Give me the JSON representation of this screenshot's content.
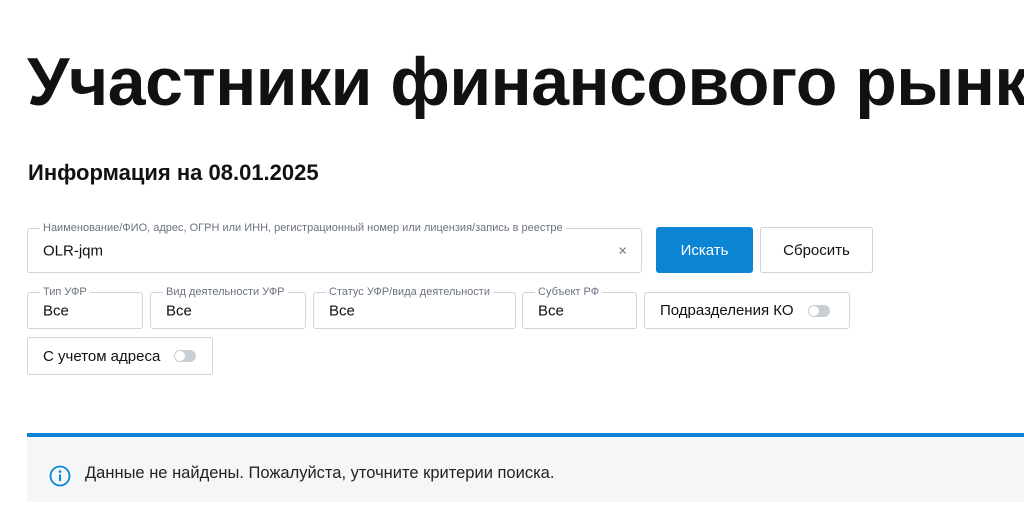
{
  "header": {
    "title": "Участники финансового рынка",
    "info_date": "Информация на 08.01.2025"
  },
  "search": {
    "label": "Наименование/ФИО, адрес, ОГРН или ИНН, регистрационный номер или лицензия/запись в реестре",
    "value": "OLR-jqm",
    "clear_symbol": "×",
    "submit_label": "Искать",
    "reset_label": "Сбросить"
  },
  "filters": {
    "type": {
      "label": "Тип УФР",
      "value": "Все"
    },
    "activity": {
      "label": "Вид деятельности УФР",
      "value": "Все"
    },
    "status": {
      "label": "Статус УФР/вида деятельности",
      "value": "Все"
    },
    "region": {
      "label": "Субъект РФ",
      "value": "Все"
    },
    "ko_divisions": {
      "label": "Подразделения КО",
      "checked": false
    },
    "with_address": {
      "label": "С учетом адреса",
      "checked": false
    }
  },
  "notice": {
    "icon": "info-icon",
    "message": "Данные не найдены. Пожалуйста, уточните критерии поиска."
  },
  "colors": {
    "accent": "#0b84d4",
    "notice_bg": "#f4f6f8",
    "border": "#cfd4da"
  }
}
